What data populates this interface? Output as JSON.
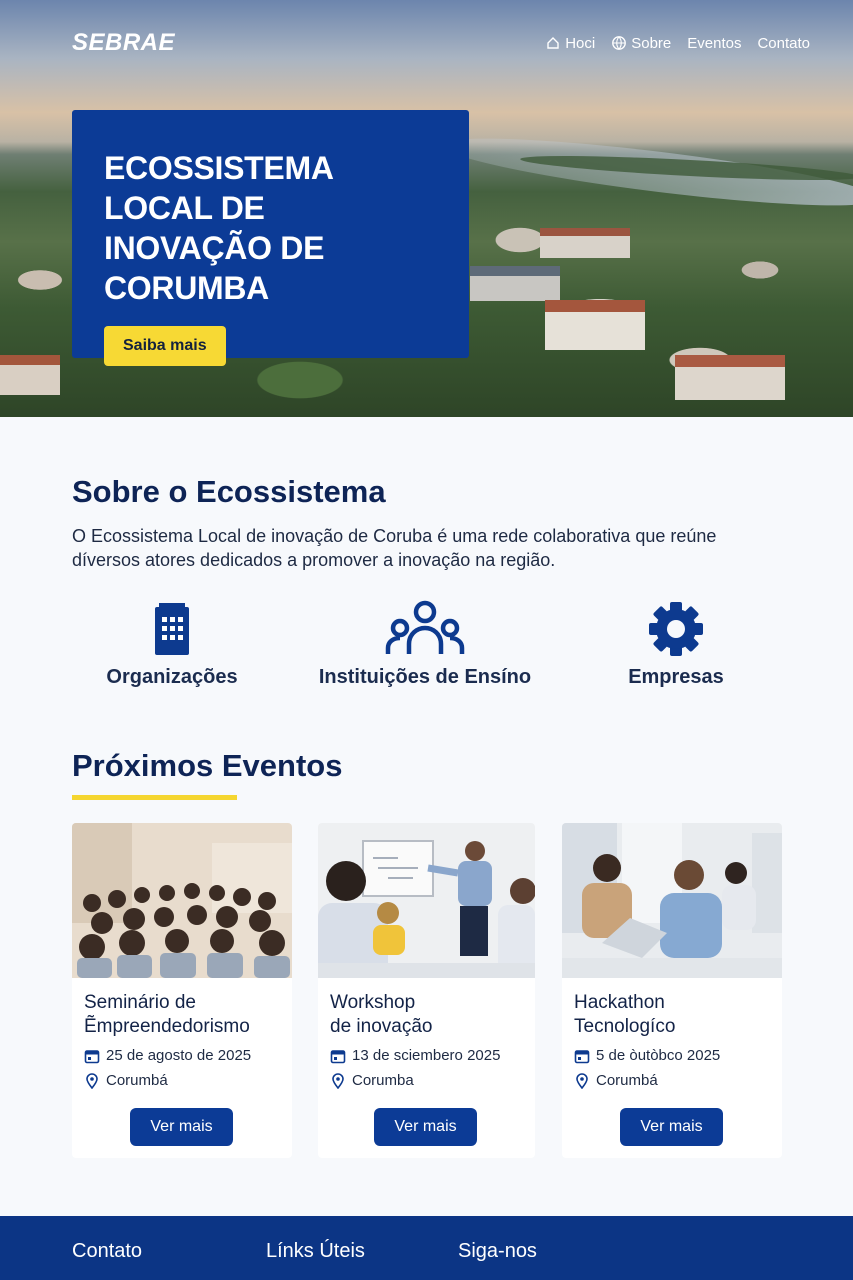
{
  "nav": {
    "logo": "SEBRAE",
    "links": [
      {
        "label": "Hoci",
        "icon": "home-icon"
      },
      {
        "label": "Sobre",
        "icon": "globe-icon"
      },
      {
        "label": "Eventos"
      },
      {
        "label": "Contato"
      }
    ]
  },
  "hero": {
    "title": "ECOSSISTEMA LOCAL DE INOVAÇÃO DE CORUMBA",
    "button": "Saiba mais"
  },
  "about": {
    "title": "Sobre o Ecossistema",
    "text": "O Ecossistema Local de inovação de Coruba é uma rede colaborativa que reúne díversos atores dedicados a promover a inovação na região.",
    "features": [
      {
        "label": "Organizações",
        "icon": "building-icon"
      },
      {
        "label": "Instituições de Ensíno",
        "icon": "people-icon"
      },
      {
        "label": "Empresas",
        "icon": "gear-icon"
      }
    ]
  },
  "events": {
    "title": "Próximos Eventos",
    "items": [
      {
        "title": "Seminário de\nẼmpreendedorismo",
        "date": "25 de agosto de 2025",
        "location": "Corumbá",
        "button": "Ver mais"
      },
      {
        "title": "Workshop\nde inovação",
        "date": "13 de sciembero 2025",
        "location": "Corumba",
        "button": "Ver mais"
      },
      {
        "title": "Hackathon\nTecnologíco",
        "date": "5 de òutòbco 2025",
        "location": "Corumbá",
        "button": "Ver mais"
      }
    ]
  },
  "footer": {
    "cols": [
      "Contato",
      "Línks Úteis",
      "Siga-nos"
    ]
  },
  "colors": {
    "primary": "#0c3b96",
    "accent": "#f7d934",
    "footer": "#0c3585"
  }
}
